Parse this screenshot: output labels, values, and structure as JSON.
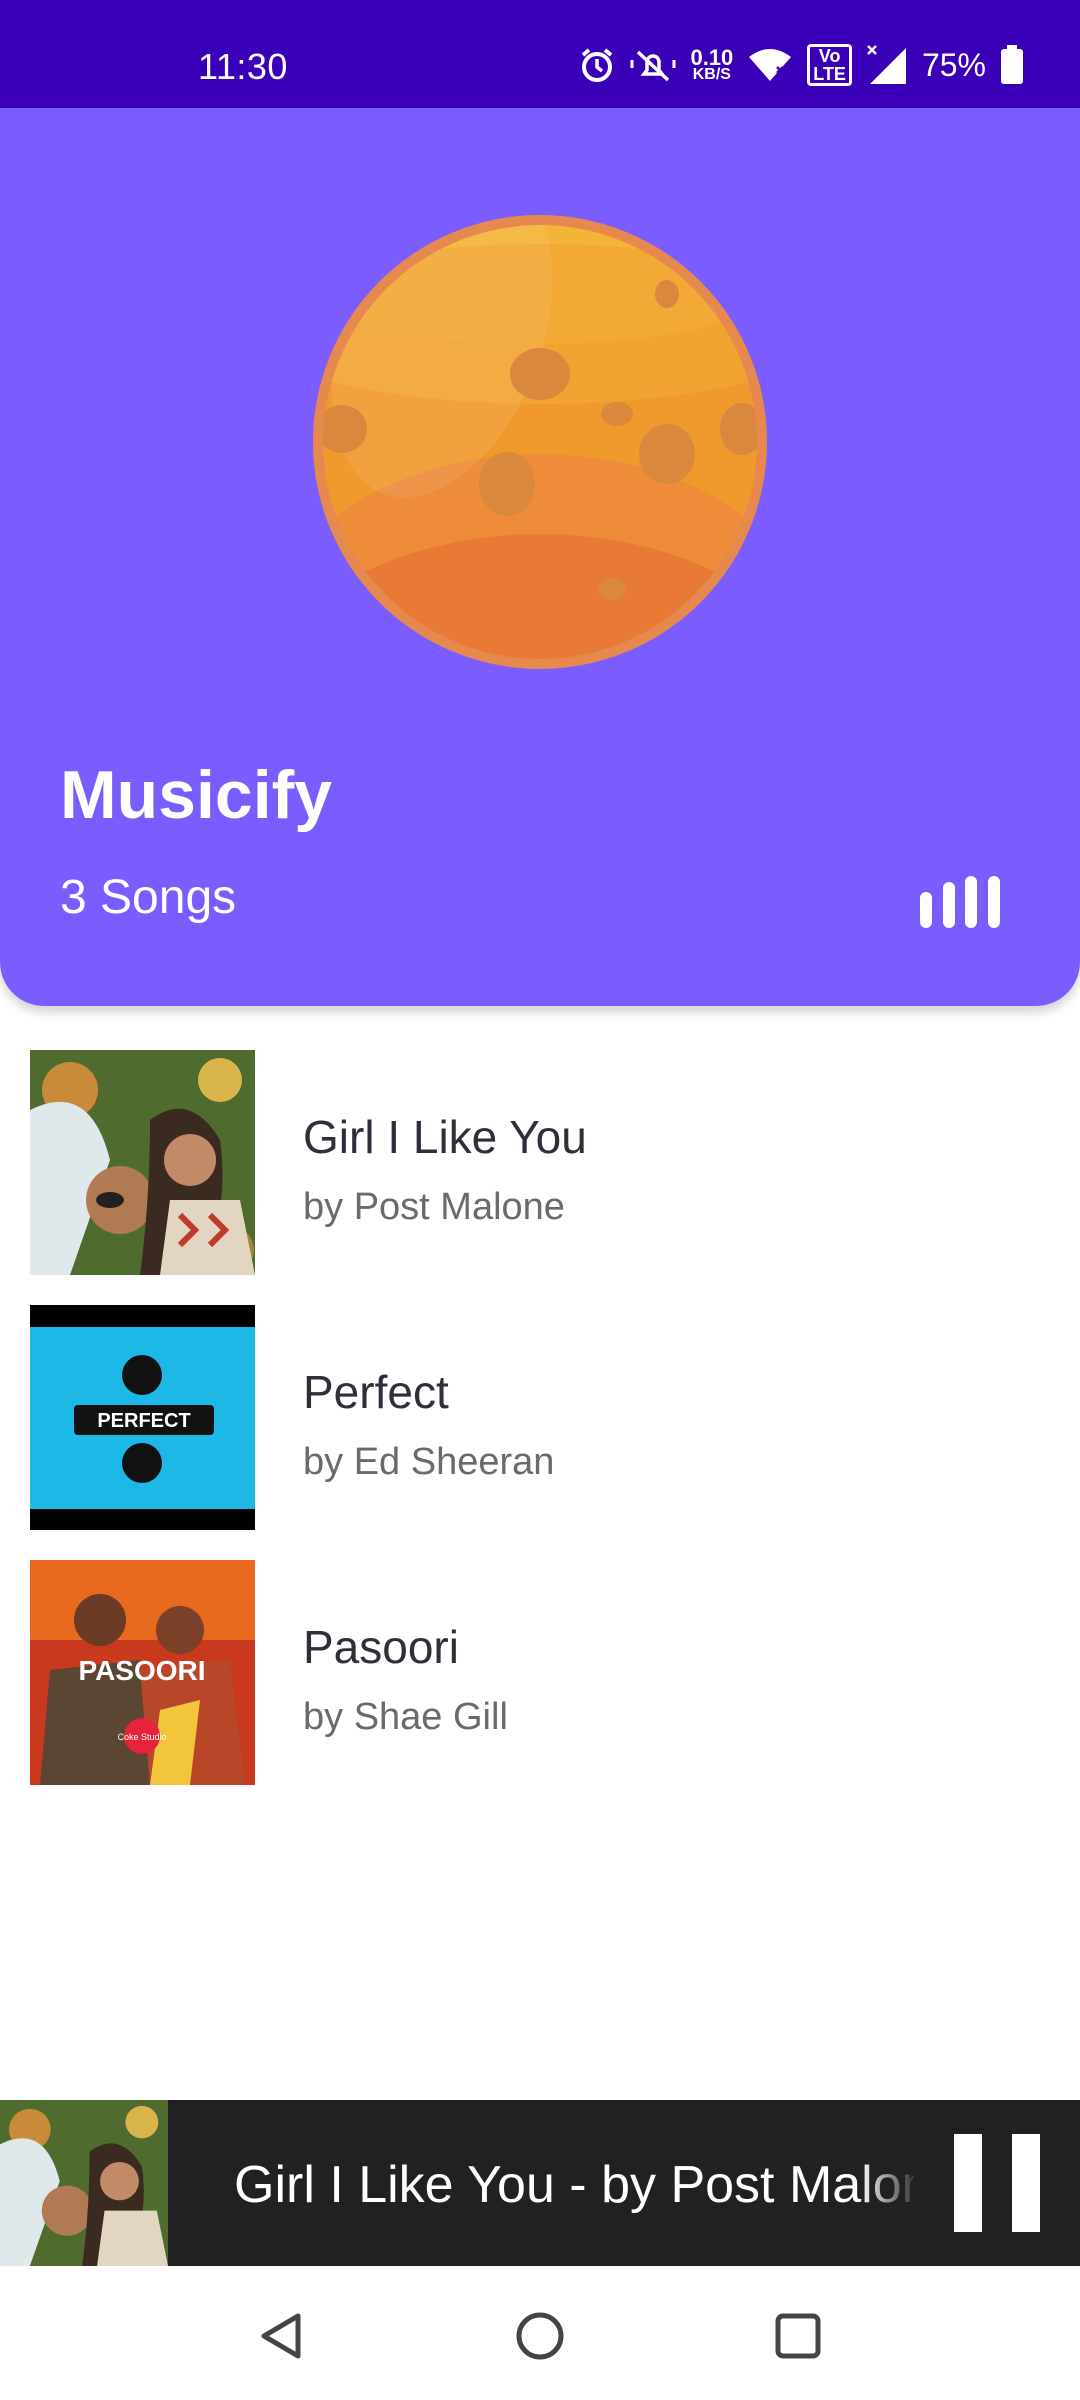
{
  "status_bar": {
    "time": "11:30",
    "net_speed_value": "0.10",
    "net_speed_unit": "KB/S",
    "volte_top": "Vo",
    "volte_bottom": "LTE",
    "battery_percent": "75%"
  },
  "header": {
    "app_title": "Musicify",
    "song_count": "3 Songs"
  },
  "songs": [
    {
      "title": "Girl I Like You",
      "artist": "by Post Malone"
    },
    {
      "title": "Perfect",
      "artist": "by Ed Sheeran",
      "art_text": "PERFECT"
    },
    {
      "title": "Pasoori",
      "artist": "by Shae Gill",
      "art_text": "PASOORI",
      "art_badge": "Coke Studio"
    }
  ],
  "mini_player": {
    "now_playing": "Girl I Like You - by Post Malone"
  },
  "colors": {
    "status_bar": "#3a00b8",
    "header": "#7b5cff",
    "mini_player": "#212121"
  },
  "icons": {
    "status": [
      "alarm-icon",
      "mute-icon",
      "wifi-icon",
      "signal-icon",
      "battery-icon"
    ],
    "header": "equalizer-bars-icon",
    "nav": [
      "back-icon",
      "home-icon",
      "recents-icon"
    ]
  }
}
